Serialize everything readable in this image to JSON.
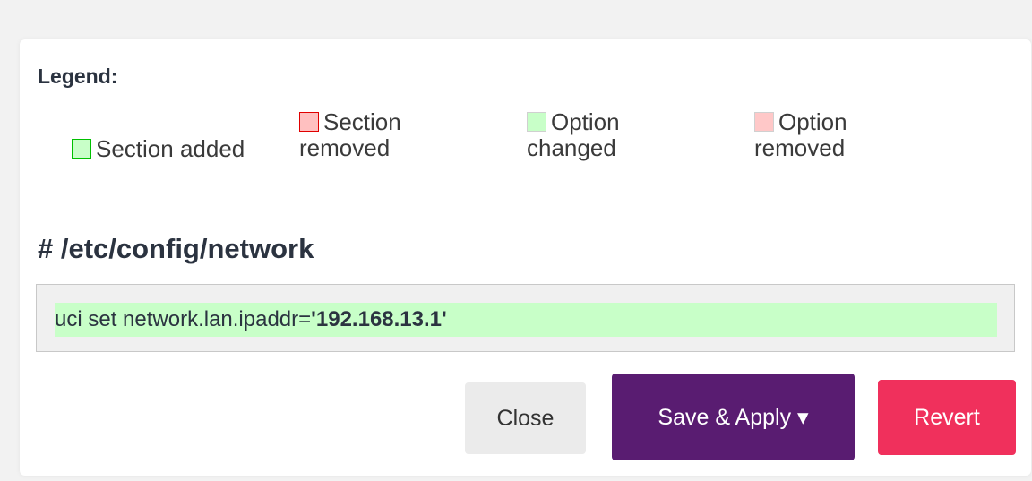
{
  "legend": {
    "title": "Legend:",
    "items": [
      {
        "label_line1": "Section added",
        "label_line2": ""
      },
      {
        "label_line1": "Section",
        "label_line2": "removed"
      },
      {
        "label_line1": "Option",
        "label_line2": "changed"
      },
      {
        "label_line1": "Option",
        "label_line2": "removed"
      }
    ]
  },
  "config": {
    "title": "# /etc/config/network",
    "changes": [
      {
        "command": "uci set network.lan.ipaddr=",
        "value": "'192.168.13.1'",
        "status": "option-changed"
      }
    ]
  },
  "buttons": {
    "close": "Close",
    "save_apply": "Save & Apply ▾",
    "revert": "Revert"
  },
  "colors": {
    "save_apply": "#591c71",
    "revert": "#f0305c",
    "changed_bg": "#c8ffc8",
    "removed_bg": "#ffc8c8"
  }
}
